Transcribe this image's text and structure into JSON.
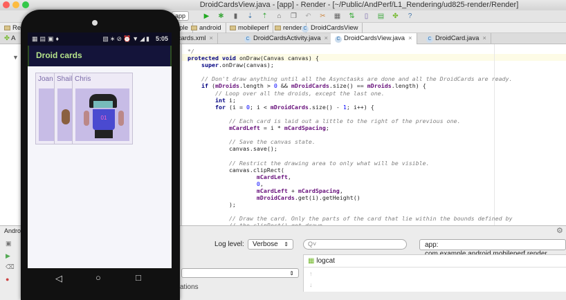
{
  "window": {
    "title": "DroidCardsView.java - [app] - Render - [~/Public/AndPerf/L1_Rendering/ud825-render/Render]"
  },
  "toolbar": {
    "run_config": "app"
  },
  "breadcrumbs": [
    "Render",
    "example",
    "android",
    "mobileperf",
    "render",
    "DroidCardsView"
  ],
  "tabs": [
    {
      "label": "activity_droid_cards.xml"
    },
    {
      "label": "DroidCardsActivity.java"
    },
    {
      "label": "DroidCardsView.java",
      "active": true
    },
    {
      "label": "DroidCard.java"
    }
  ],
  "code_lines": [
    [
      [
        "cm",
        "*/"
      ]
    ],
    [
      [
        "kw",
        "protected void "
      ],
      [
        "",
        "onDraw(Canvas canvas) {"
      ]
    ],
    [
      [
        "",
        "    "
      ],
      [
        "kw",
        "super"
      ],
      [
        "",
        ".onDraw(canvas);"
      ]
    ],
    [
      [
        "",
        ""
      ]
    ],
    [
      [
        "cm",
        "    // Don't draw anything until all the Asynctasks are done and all the DroidCards are ready."
      ]
    ],
    [
      [
        "kw",
        "    if "
      ],
      [
        "",
        "("
      ],
      [
        "fd",
        "mDroids"
      ],
      [
        "",
        ".length > "
      ],
      [
        "nm",
        "0"
      ],
      [
        "",
        " && "
      ],
      [
        "fd",
        "mDroidCards"
      ],
      [
        "",
        ".size() == "
      ],
      [
        "fd",
        "mDroids"
      ],
      [
        "",
        ".length) {"
      ]
    ],
    [
      [
        "cm",
        "        // Loop over all the droids, except the last one."
      ]
    ],
    [
      [
        "kw",
        "        int "
      ],
      [
        "",
        "i;"
      ]
    ],
    [
      [
        "kw",
        "        for "
      ],
      [
        "",
        "(i = "
      ],
      [
        "nm",
        "0"
      ],
      [
        "",
        "; i < "
      ],
      [
        "fd",
        "mDroidCards"
      ],
      [
        "",
        ".size() - "
      ],
      [
        "nm",
        "1"
      ],
      [
        "",
        "; i++) {"
      ]
    ],
    [
      [
        "",
        ""
      ]
    ],
    [
      [
        "cm",
        "            // Each card is laid out a little to the right of the previous one."
      ]
    ],
    [
      [
        "fd",
        "            mCardLeft"
      ],
      [
        "",
        " = i * "
      ],
      [
        "fd",
        "mCardSpacing"
      ],
      [
        "",
        ";"
      ]
    ],
    [
      [
        "",
        ""
      ]
    ],
    [
      [
        "cm",
        "            // Save the canvas state."
      ]
    ],
    [
      [
        "",
        "            canvas.save();"
      ]
    ],
    [
      [
        "",
        ""
      ]
    ],
    [
      [
        "cm",
        "            // Restrict the drawing area to only what will be visible."
      ]
    ],
    [
      [
        "",
        "            canvas.clipRect("
      ]
    ],
    [
      [
        "fd",
        "                    mCardLeft"
      ],
      [
        "",
        ","
      ]
    ],
    [
      [
        "nm",
        "                    0"
      ],
      [
        "",
        ","
      ]
    ],
    [
      [
        "fd",
        "                    mCardLeft"
      ],
      [
        "",
        " + "
      ],
      [
        "fd",
        "mCardSpacing"
      ],
      [
        "",
        ","
      ]
    ],
    [
      [
        "fd",
        "                    mDroidCards"
      ],
      [
        "",
        ".get(i).getHeight()"
      ]
    ],
    [
      [
        "",
        "            );"
      ]
    ],
    [
      [
        "",
        ""
      ]
    ],
    [
      [
        "cm",
        "            // Draw the card. Only the parts of the card that lie within the bounds defined by"
      ]
    ],
    [
      [
        "cm",
        "            // the clipRect() get drawn."
      ]
    ]
  ],
  "logcat": {
    "log_level_label": "Log level:",
    "log_level_value": "Verbose",
    "search_placeholder": "Q˅",
    "app_filter": "app: com.example.android.mobileperf.render",
    "panel_title": "logcat",
    "left_item": "cations"
  },
  "left_panel": {
    "tab_label": "A",
    "bottom_label": "Andro"
  },
  "phone": {
    "time": "5:05",
    "app_title": "Droid cards",
    "cards": [
      {
        "name": "Joan"
      },
      {
        "name": "Shaila"
      },
      {
        "name": "Chris"
      }
    ],
    "jersey_number": "01",
    "nav": {
      "back": "◁",
      "home": "○",
      "recents": "□"
    }
  },
  "colors": {
    "appbar": "#14143a",
    "appbar_text": "#b6e38a",
    "card_bg": "#c7bce6"
  }
}
